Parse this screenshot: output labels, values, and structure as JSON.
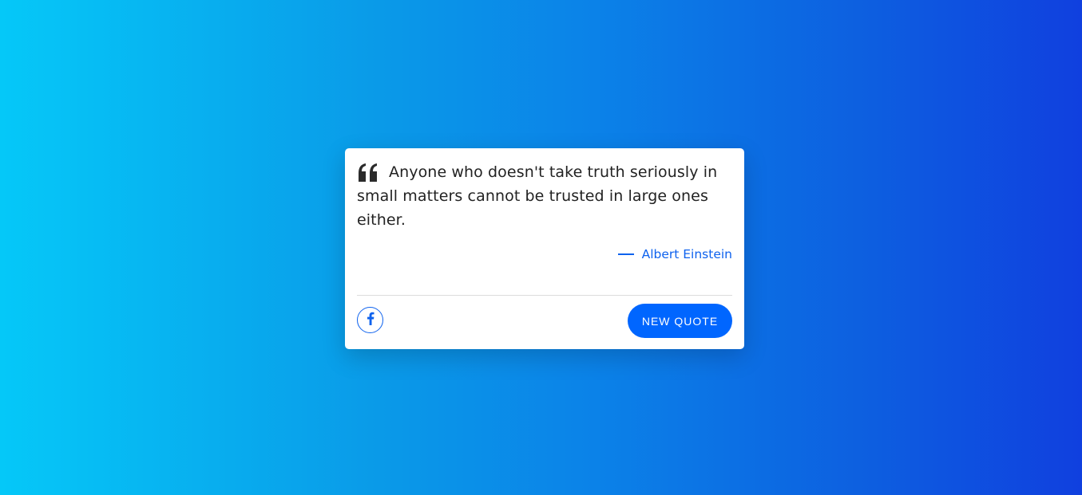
{
  "quote": {
    "text": "Anyone who doesn't take truth seriously in small matters cannot be trusted in large ones either.",
    "icon": "quote-left-icon"
  },
  "author": {
    "dash": "—",
    "name": "Albert Einstein"
  },
  "actions": {
    "share_icon": "facebook-icon",
    "new_quote_label": "NEW QUOTE"
  },
  "colors": {
    "accent": "#0066ff",
    "author": "#0e62ee",
    "text": "#222222",
    "background_start": "#05c8f8",
    "background_end": "#1040df"
  }
}
